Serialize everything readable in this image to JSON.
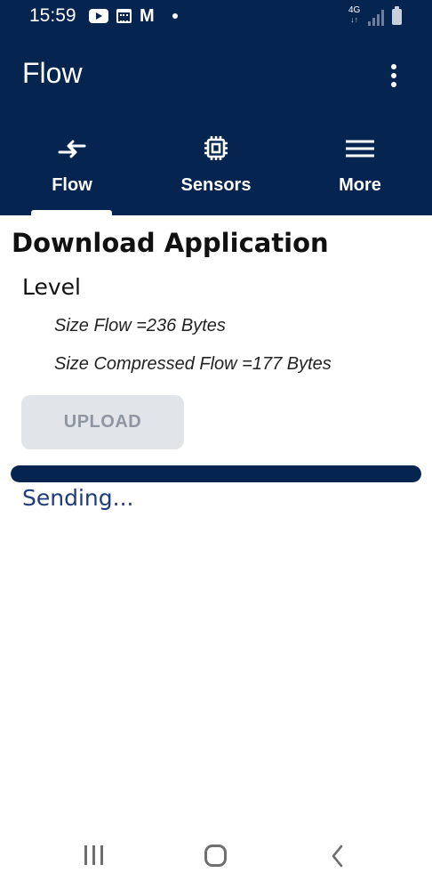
{
  "status_bar": {
    "time": "15:59",
    "network_label": "4G",
    "network_arrows": "↓↑",
    "icons": [
      "youtube-icon",
      "calendar-icon",
      "gmail-icon",
      "notification-dot-icon",
      "signal-icon",
      "battery-icon"
    ]
  },
  "app_bar": {
    "title": "Flow",
    "overflow_icon": "more-vert-icon"
  },
  "tabs": [
    {
      "label": "Flow",
      "icon": "swap-arrows-icon",
      "selected": true
    },
    {
      "label": "Sensors",
      "icon": "chip-icon",
      "selected": false
    },
    {
      "label": "More",
      "icon": "menu-icon",
      "selected": false
    }
  ],
  "content": {
    "title": "Download Application",
    "level_label": "Level",
    "size_flow": "Size Flow =236 Bytes",
    "size_compressed": "Size Compressed Flow =177 Bytes",
    "upload_label": "UPLOAD",
    "upload_enabled": false,
    "progress_fraction": 1.0,
    "status": "Sending..."
  },
  "colors": {
    "primary": "#05244f",
    "status_text": "#1f3b7c",
    "disabled_bg": "#e1e4e9",
    "disabled_text": "#8e96a2"
  },
  "nav_bar": {
    "icons": [
      "recents-icon",
      "home-icon",
      "back-icon"
    ]
  }
}
